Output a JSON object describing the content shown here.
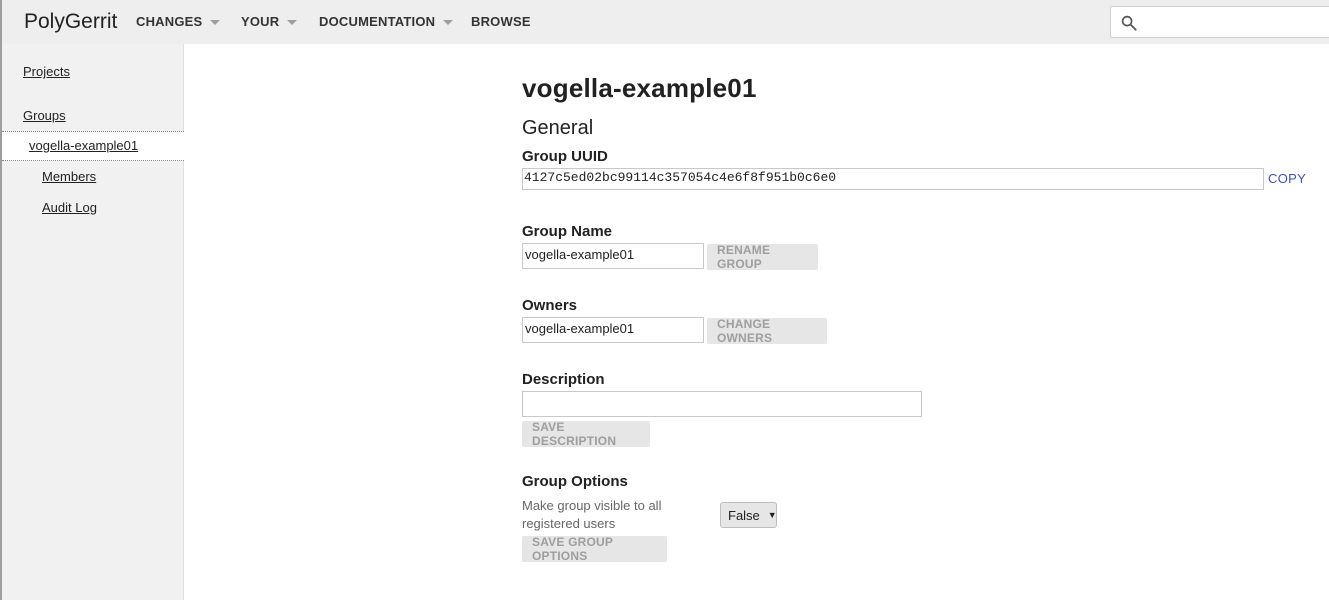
{
  "header": {
    "brand": "PolyGerrit",
    "nav": [
      {
        "label": "CHANGES",
        "has_menu": true
      },
      {
        "label": "YOUR",
        "has_menu": true
      },
      {
        "label": "DOCUMENTATION",
        "has_menu": true
      },
      {
        "label": "BROWSE",
        "has_menu": false
      }
    ],
    "search": {
      "placeholder": "",
      "value": "",
      "icon": "search-icon"
    }
  },
  "sidebar": {
    "projects": "Projects",
    "groups": "Groups",
    "active_group": "vogella-example01",
    "sub_items": [
      "Members",
      "Audit Log"
    ]
  },
  "main": {
    "title": "vogella-example01",
    "general_heading": "General",
    "uuid": {
      "label": "Group UUID",
      "value": "4127c5ed02bc99114c357054c4e6f8f951b0c6e0",
      "copy_label": "COPY"
    },
    "name": {
      "label": "Group Name",
      "value": "vogella-example01",
      "button": "RENAME GROUP"
    },
    "owners": {
      "label": "Owners",
      "value": "vogella-example01",
      "button": "CHANGE OWNERS"
    },
    "description": {
      "label": "Description",
      "value": "",
      "button": "SAVE DESCRIPTION"
    },
    "options": {
      "label": "Group Options",
      "visible_line1": "Make group visible to all",
      "visible_line2": "registered users",
      "select_value": "False",
      "button": "SAVE GROUP OPTIONS"
    }
  },
  "colors": {
    "header_bg": "#eeeeee",
    "sidebar_bg": "#f1f1f1",
    "link_accent": "#3f51b5",
    "button_bg": "#e6e6e6"
  }
}
